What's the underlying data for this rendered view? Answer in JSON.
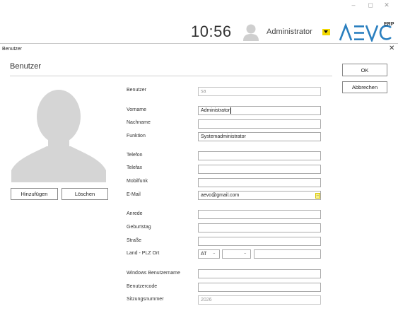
{
  "window_controls": {
    "minimize": "–",
    "maximize": "◻",
    "close": "✕"
  },
  "header": {
    "clock": "10:56",
    "user_name": "Administrator",
    "user_avatar_icon": "user-silhouette-icon",
    "dropdown_icon": "caret-down-icon",
    "logo_text": "AEVO",
    "logo_suffix": "ERP",
    "accent_color": "#f2d800"
  },
  "dialog": {
    "caption": "Benutzer",
    "close_glyph": "✕",
    "title": "Benutzer",
    "ok_label": "OK",
    "cancel_label": "Abbrechen",
    "photo": {
      "placeholder_icon": "user-silhouette-icon",
      "add_label": "Hinzufügen",
      "delete_label": "Löschen"
    }
  },
  "form": {
    "benutzer": {
      "label": "Benutzer",
      "value": "sa"
    },
    "vorname": {
      "label": "Vorname",
      "value": "Administrator"
    },
    "nachname": {
      "label": "Nachname",
      "value": ""
    },
    "funktion": {
      "label": "Funktion",
      "value": "Systemadministrator"
    },
    "telefon": {
      "label": "Telefon",
      "value": ""
    },
    "telefax": {
      "label": "Telefax",
      "value": ""
    },
    "mobilfunk": {
      "label": "Mobilfunk",
      "value": ""
    },
    "email": {
      "label": "E-Mail",
      "value": "aevo@gmail.com",
      "action_glyph": "..."
    },
    "anrede": {
      "label": "Anrede",
      "value": ""
    },
    "geburtstag": {
      "label": "Geburtstag",
      "value": ""
    },
    "strasse": {
      "label": "Straße",
      "value": ""
    },
    "land_plz_ort": {
      "label": "Land - PLZ Ort",
      "land": "AT",
      "land_arrow": "--",
      "plz": "",
      "plz_arrow": "--",
      "ort": ""
    },
    "windows_benutzername": {
      "label": "Windows Benutzername",
      "value": ""
    },
    "benutzercode": {
      "label": "Benutzercode",
      "value": ""
    },
    "sitzungsnummer": {
      "label": "Sitzungsnummer",
      "value": "2026"
    }
  }
}
